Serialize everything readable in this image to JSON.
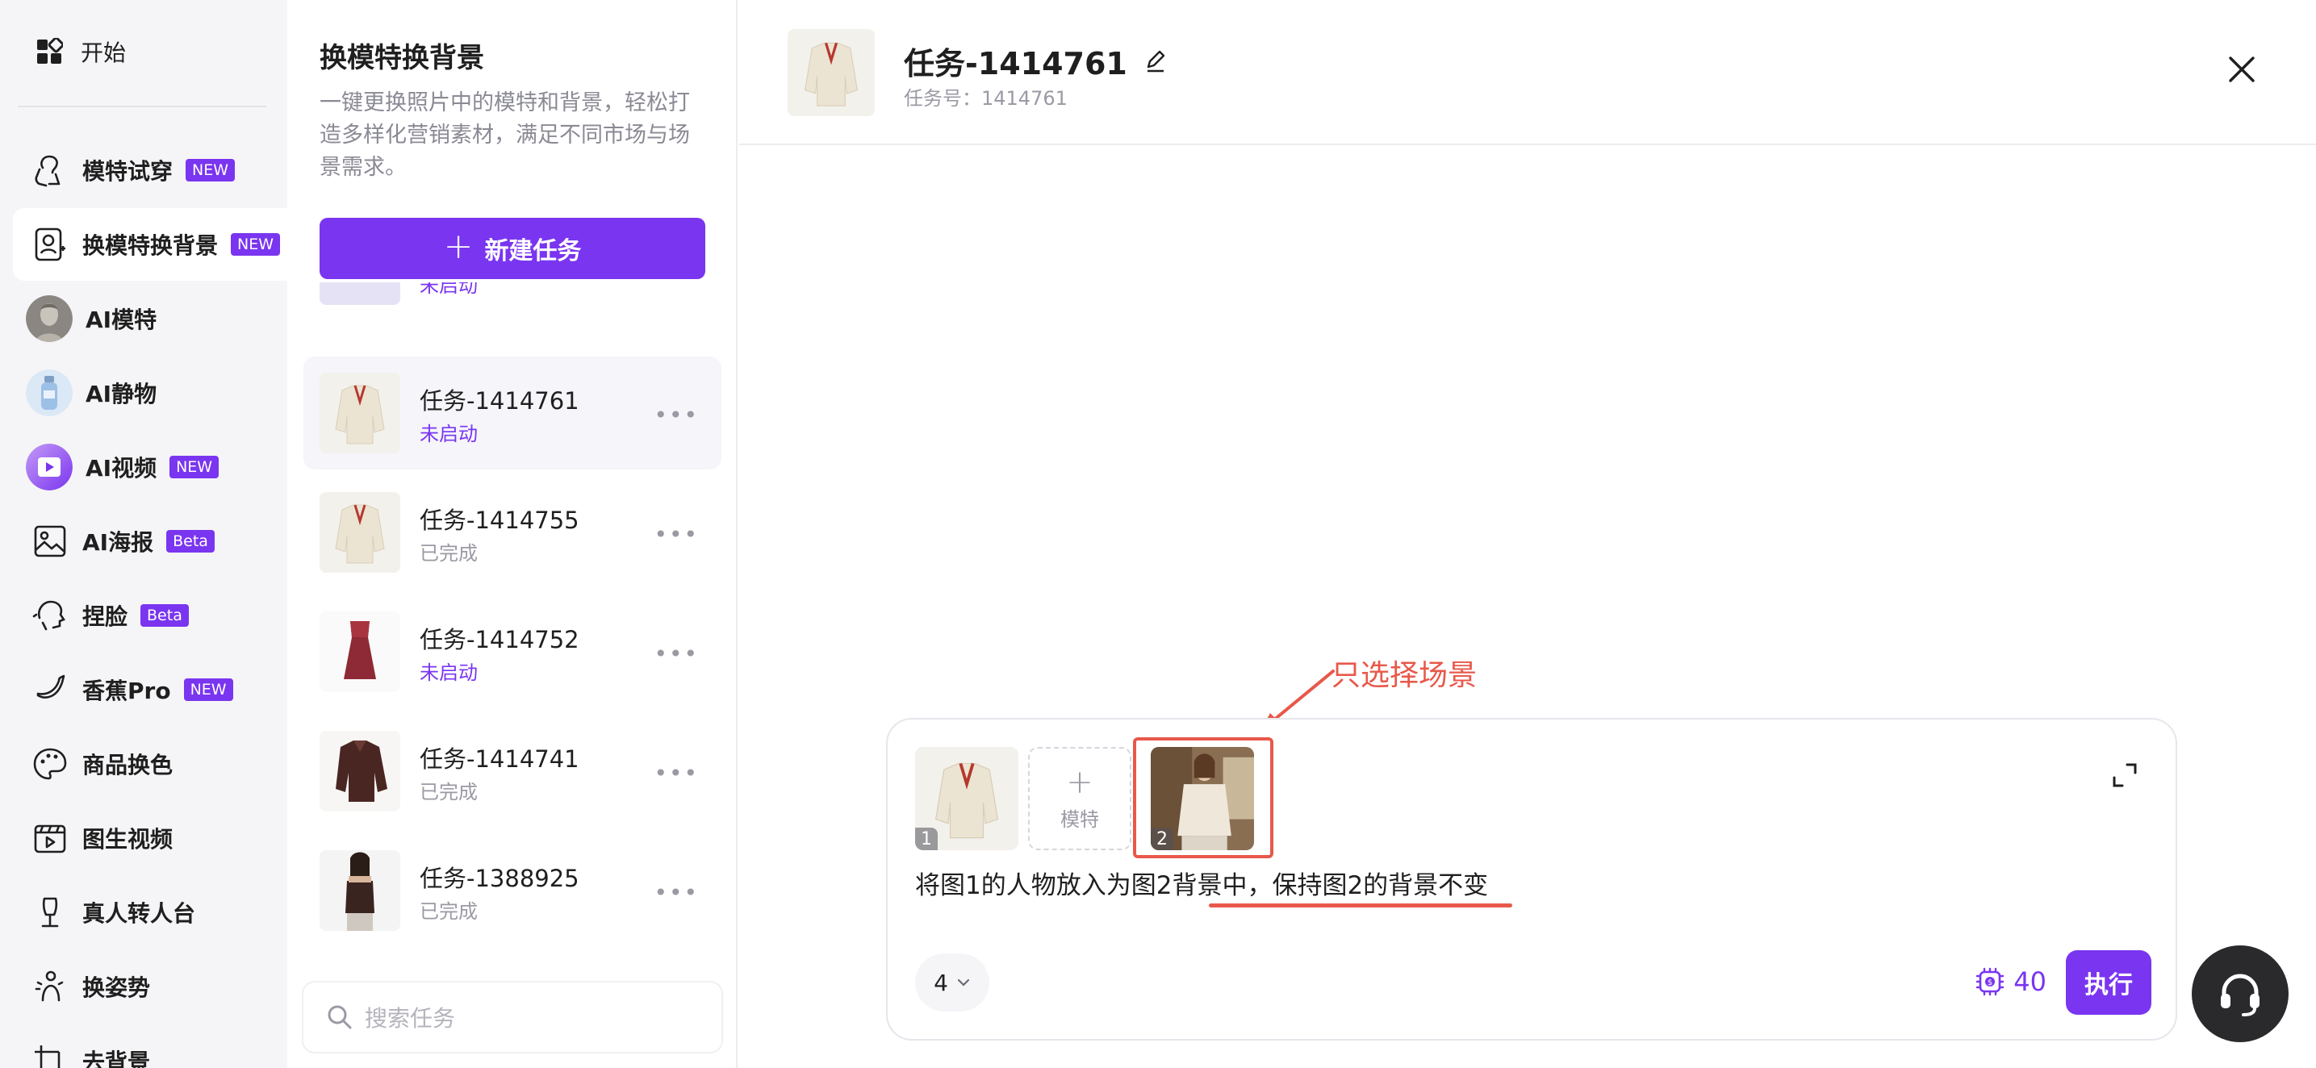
{
  "nav": {
    "start_label": "开始",
    "items": [
      {
        "label": "模特试穿",
        "badge": "NEW",
        "icon": "hanger-person-icon"
      },
      {
        "label": "换模特换背景",
        "badge": "NEW",
        "icon": "portrait-frame-icon"
      },
      {
        "label": "AI模特",
        "badge": "",
        "icon": "statue-avatar"
      },
      {
        "label": "AI静物",
        "badge": "",
        "icon": "bottle-avatar"
      },
      {
        "label": "AI视频",
        "badge": "NEW",
        "icon": "video-avatar"
      },
      {
        "label": "AI海报",
        "badge": "Beta",
        "icon": "image-icon"
      },
      {
        "label": "捏脸",
        "badge": "Beta",
        "icon": "face-sculpt-icon"
      },
      {
        "label": "香蕉Pro",
        "badge": "NEW",
        "icon": "banana-icon"
      },
      {
        "label": "商品换色",
        "badge": "",
        "icon": "palette-icon"
      },
      {
        "label": "图生视频",
        "badge": "",
        "icon": "clapper-icon"
      },
      {
        "label": "真人转人台",
        "badge": "",
        "icon": "mannequin-icon"
      },
      {
        "label": "换姿势",
        "badge": "",
        "icon": "pose-icon"
      },
      {
        "label": "去背景",
        "badge": "",
        "icon": "remove-bg-icon"
      }
    ]
  },
  "feature": {
    "title": "换模特换背景",
    "description": "一键更换照片中的模特和背景，轻松打造多样化营销素材，满足不同市场与场景需求。",
    "new_task_label": "新建任务"
  },
  "tasks": [
    {
      "name": "",
      "status": "未启动",
      "state": "pending",
      "thumb": "placeholder"
    },
    {
      "name": "任务-1414761",
      "status": "未启动",
      "state": "pending",
      "thumb": "cream-sweater"
    },
    {
      "name": "任务-1414755",
      "status": "已完成",
      "state": "done",
      "thumb": "cream-sweater"
    },
    {
      "name": "任务-1414752",
      "status": "未启动",
      "state": "pending",
      "thumb": "red-dress"
    },
    {
      "name": "任务-1414741",
      "status": "已完成",
      "state": "done",
      "thumb": "brown-jacket"
    },
    {
      "name": "任务-1388925",
      "status": "已完成",
      "state": "done",
      "thumb": "model-camisole"
    }
  ],
  "search": {
    "placeholder": "搜索任务"
  },
  "header": {
    "title": "任务-1414761",
    "subtitle": "任务号：1414761"
  },
  "annotation": {
    "text": "只选择场景",
    "color": "#e8584a"
  },
  "composer": {
    "images": [
      {
        "index": "1"
      },
      {
        "index": "2"
      }
    ],
    "add_model_label": "模特",
    "prompt": "将图1的人物放入为图2背景中，保持图2的背景不变",
    "count": "4",
    "cost": "40",
    "run_label": "执行"
  },
  "colors": {
    "accent": "#7a35f0",
    "annotation": "#e8584a"
  }
}
